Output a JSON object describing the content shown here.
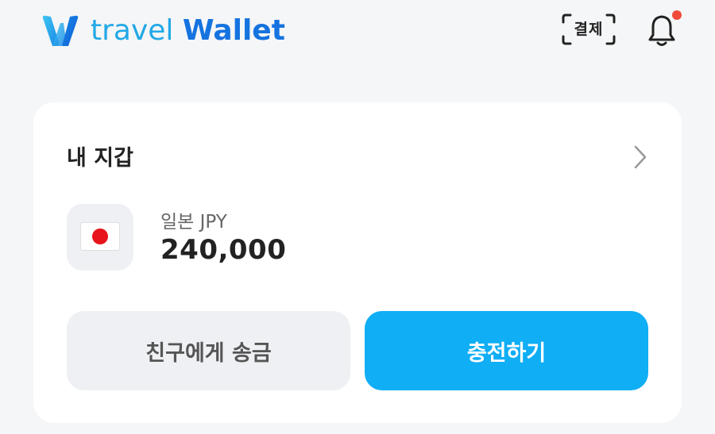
{
  "header": {
    "logo_text_light": "travel",
    "logo_text_bold": "Wallet",
    "pay_label": "결제",
    "notification_dot_color": "#f04a3a"
  },
  "wallet": {
    "title": "내 지갑",
    "currency_label": "일본 JPY",
    "amount": "240,000",
    "send_button": "친구에게 송금",
    "charge_button": "충전하기"
  },
  "colors": {
    "accent": "#10aef5",
    "brand_blue": "#1573e0",
    "brand_light": "#22a8e6"
  }
}
